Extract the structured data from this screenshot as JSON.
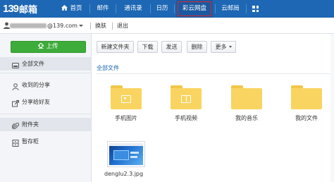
{
  "app": {
    "logo_number": "139",
    "logo_text": "邮箱"
  },
  "nav": {
    "items": [
      {
        "label": "首页"
      },
      {
        "label": "邮件"
      },
      {
        "label": "通讯录"
      },
      {
        "label": "日历"
      },
      {
        "label": "彩云网盘",
        "active": true
      },
      {
        "label": "云邮局"
      }
    ],
    "apps_icon": "grid-icon"
  },
  "userbar": {
    "email_visible": "@139.com",
    "switch_label": "换肤",
    "logout_label": "退出"
  },
  "sidebar": {
    "upload_label": "上传",
    "items": [
      {
        "label": "全部文件",
        "icon": "drive-icon",
        "selected": true
      },
      {
        "label": "收到的分享",
        "icon": "user-share-icon"
      },
      {
        "label": "分享给好友",
        "icon": "send-share-icon"
      },
      {
        "label": "附件夹",
        "icon": "paperclip-icon",
        "selected": true
      },
      {
        "label": "暂存柜",
        "icon": "cabinet-icon"
      }
    ]
  },
  "toolbar": {
    "new_folder": "新建文件夹",
    "download": "下载",
    "send": "发送",
    "delete": "删除",
    "more": "更多"
  },
  "breadcrumb": "全部文件",
  "files": {
    "folders": [
      {
        "name": "手机图片",
        "badge": "image"
      },
      {
        "name": "手机视频",
        "badge": "video"
      },
      {
        "name": "我的音乐",
        "badge": "none"
      },
      {
        "name": "我的文件",
        "badge": "none"
      }
    ],
    "images": [
      {
        "name": "denglu2.3.jpg"
      }
    ]
  },
  "colors": {
    "nav_bg": "#1d67b4",
    "upload_green": "#3eac3b",
    "folder_yellow": "#fad460",
    "link_blue": "#1a62b1",
    "active_outline": "#e0242c"
  }
}
